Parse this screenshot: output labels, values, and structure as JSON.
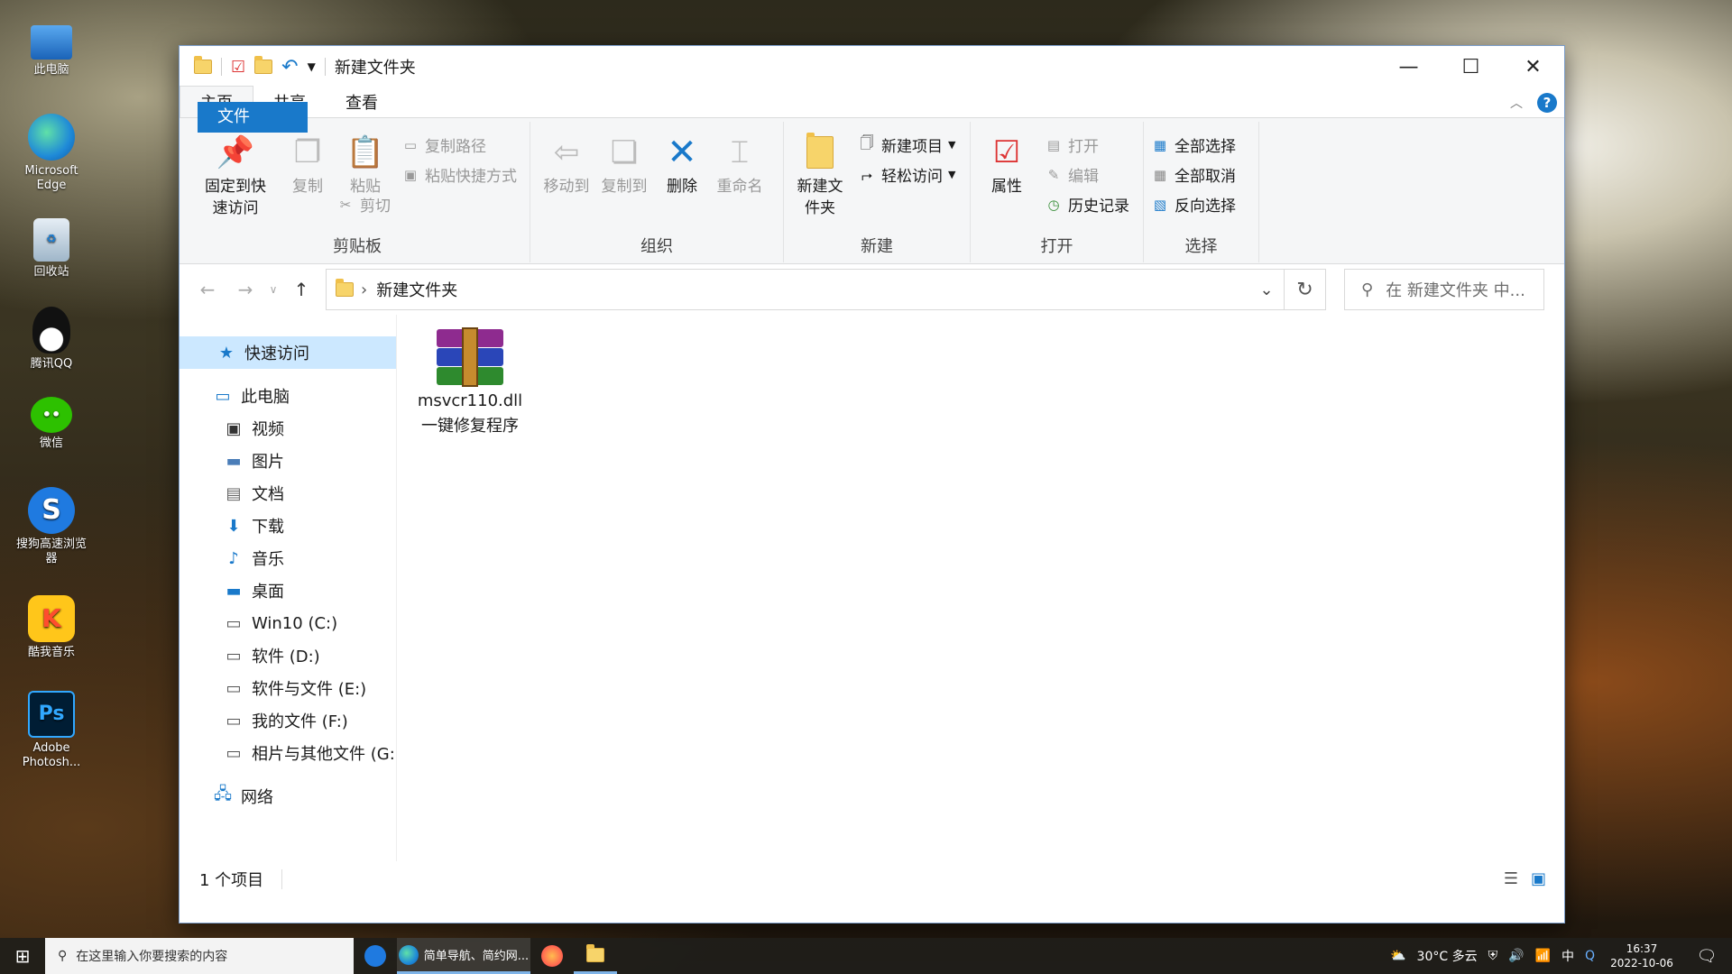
{
  "desktop": {
    "icons": [
      {
        "label": "此电脑"
      },
      {
        "label": "Microsoft Edge"
      },
      {
        "label": "回收站"
      },
      {
        "label": "腾讯QQ"
      },
      {
        "label": "微信"
      },
      {
        "label": "搜狗高速浏览器"
      },
      {
        "label": "酷我音乐"
      },
      {
        "label": "Adobe Photosh..."
      }
    ]
  },
  "window": {
    "title": "新建文件夹",
    "controls": {
      "minimize": "—",
      "maximize": "☐",
      "close": "✕"
    },
    "tabs": [
      {
        "label": "文件"
      },
      {
        "label": "主页"
      },
      {
        "label": "共享"
      },
      {
        "label": "查看"
      }
    ],
    "help": "?",
    "ribbon": {
      "clipboard": {
        "name": "剪贴板",
        "pin": "固定到快速访问",
        "copy": "复制",
        "paste": "粘贴",
        "copy_path": "复制路径",
        "paste_shortcut": "粘贴快捷方式",
        "cut": "剪切"
      },
      "organize": {
        "name": "组织",
        "move_to": "移动到",
        "copy_to": "复制到",
        "delete": "删除",
        "rename": "重命名"
      },
      "new": {
        "name": "新建",
        "new_folder": "新建文件夹",
        "new_item": "新建项目",
        "easy_access": "轻松访问"
      },
      "open": {
        "name": "打开",
        "properties": "属性",
        "open": "打开",
        "edit": "编辑",
        "history": "历史记录"
      },
      "select": {
        "name": "选择",
        "select_all": "全部选择",
        "select_none": "全部取消",
        "invert": "反向选择"
      }
    },
    "address": {
      "path": "新建文件夹",
      "search_placeholder": "在 新建文件夹 中..."
    },
    "nav": {
      "quick_access": "快速访问",
      "this_pc": "此电脑",
      "items": [
        {
          "label": "视频"
        },
        {
          "label": "图片"
        },
        {
          "label": "文档"
        },
        {
          "label": "下载"
        },
        {
          "label": "音乐"
        },
        {
          "label": "桌面"
        },
        {
          "label": "Win10 (C:)"
        },
        {
          "label": "软件 (D:)"
        },
        {
          "label": "软件与文件 (E:)"
        },
        {
          "label": "我的文件 (F:)"
        },
        {
          "label": "相片与其他文件 (G:"
        }
      ],
      "network": "网络"
    },
    "files": [
      {
        "name_line1": "msvcr110.dll",
        "name_line2": "一键修复程序"
      }
    ],
    "status": "1 个项目"
  },
  "taskbar": {
    "search_placeholder": "在这里输入你要搜索的内容",
    "active_app": "简单导航、简约网...",
    "weather": "30°C 多云",
    "time": "16:37",
    "date": "2022-10-06"
  }
}
